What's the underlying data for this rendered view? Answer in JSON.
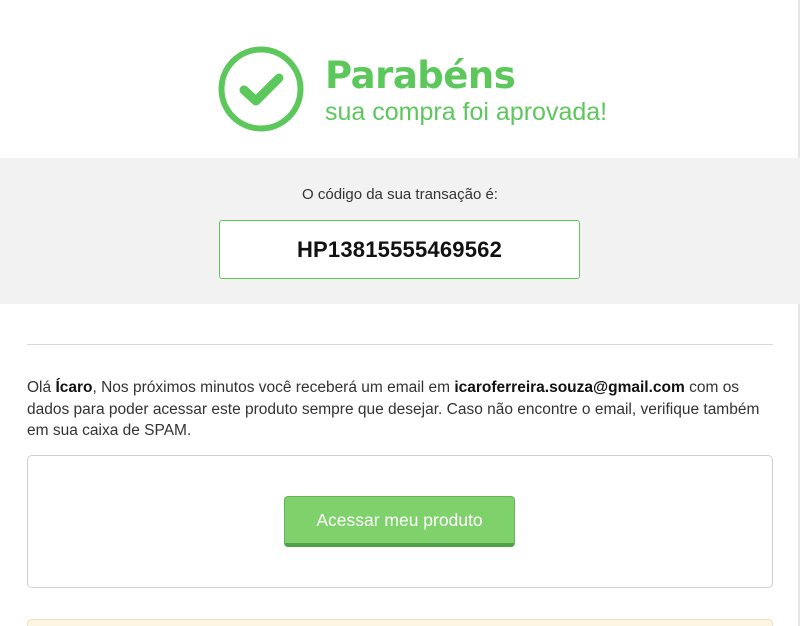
{
  "header": {
    "title": "Parabéns",
    "subtitle": "sua compra foi aprovada!",
    "icon": "check-circle-icon",
    "accent_color": "#5cc85c"
  },
  "transaction": {
    "label": "O código da sua transação é:",
    "code": "HP13815555469562"
  },
  "message": {
    "greeting": "Olá ",
    "name": "Ícaro",
    "text_part1": ", Nos próximos minutos você receberá um email em ",
    "email": "icaroferreira.souza@gmail.com",
    "text_part2": " com os dados para poder acessar este produto sempre que desejar. Caso não encontre o email, verifique também em sua caixa de SPAM."
  },
  "actions": {
    "access_button_label": "Acessar meu produto",
    "button_color": "#7ed16b"
  }
}
